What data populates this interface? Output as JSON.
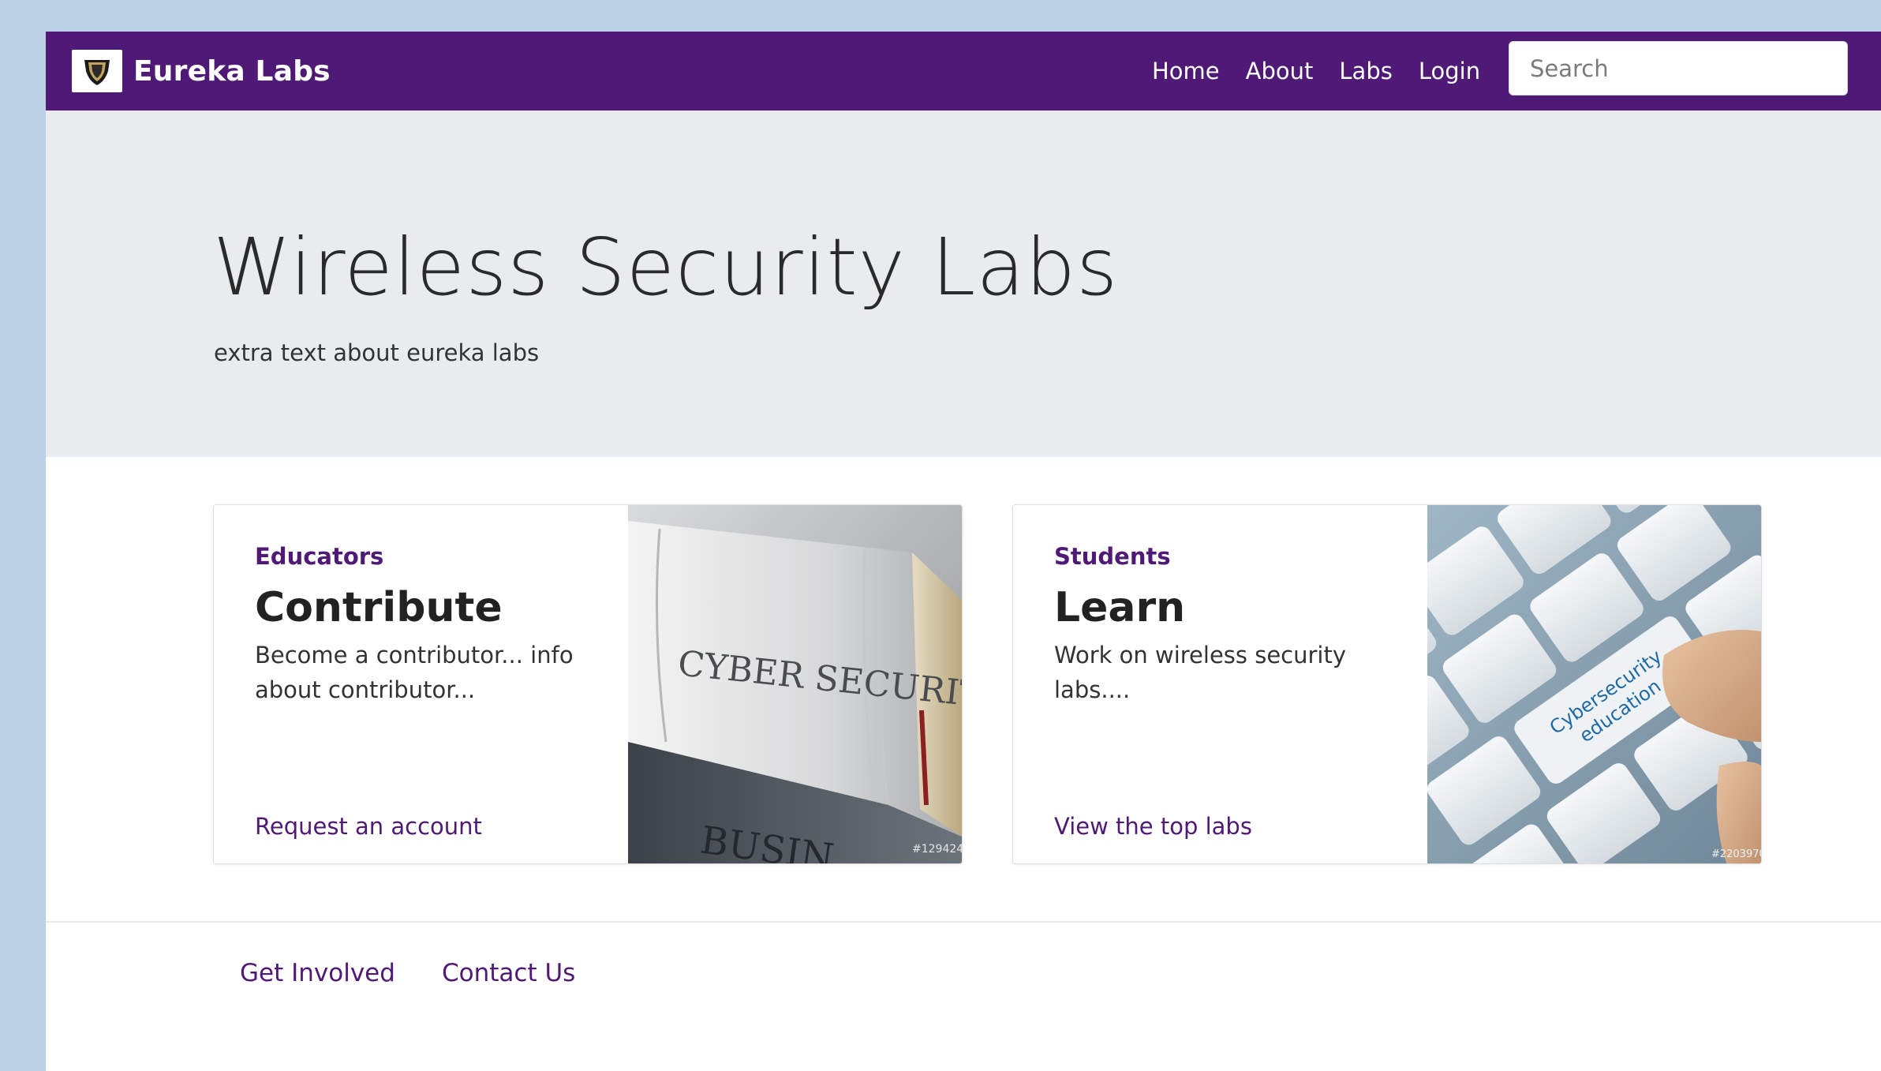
{
  "navbar": {
    "brand_name": "Eureka Labs",
    "links": [
      "Home",
      "About",
      "Labs",
      "Login"
    ],
    "search_placeholder": "Search"
  },
  "hero": {
    "title": "Wireless Security Labs",
    "subtitle": "extra text about eureka labs"
  },
  "cards": [
    {
      "subtitle": "Educators",
      "title": "Contribute",
      "text": "Become a contributor... info about contributor...",
      "link": "Request an account",
      "image_icon": "cyber-security-book-image"
    },
    {
      "subtitle": "Students",
      "title": "Learn",
      "text": "Work on wireless security labs....",
      "link": "View the top labs",
      "image_icon": "cybersecurity-keyboard-image"
    }
  ],
  "footer": {
    "links": [
      "Get Involved",
      "Contact Us"
    ]
  },
  "colors": {
    "brand": "#4f1a76",
    "hero_bg": "#e9ecef",
    "page_bg": "#bcd0e6"
  }
}
